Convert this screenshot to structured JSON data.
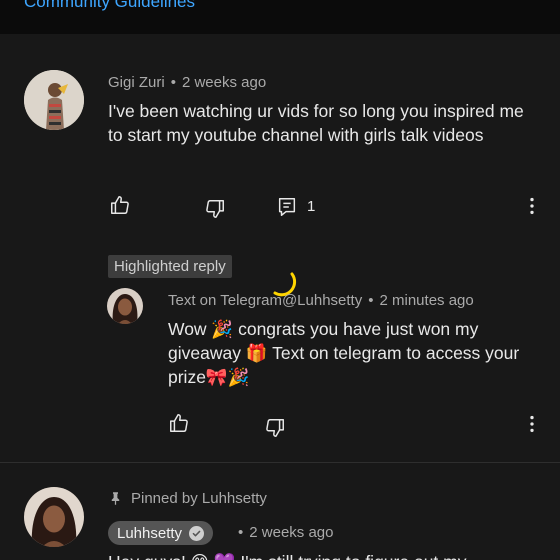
{
  "header": {
    "link": "Community Guidelines"
  },
  "comments": [
    {
      "author": "Gigi Zuri",
      "time": "2 weeks ago",
      "text": "I've been watching ur vids for so long you inspired me to start my youtube channel with girls talk videos",
      "reply_count": "1"
    }
  ],
  "highlighted": {
    "badge": "Highlighted reply",
    "author": "Text on Telegram@Luhhsetty",
    "time": "2 minutes ago",
    "text": "Wow 🎉 congrats you have just won my giveaway 🎁 Text on telegram to access your prize🎀🎉"
  },
  "pinned": {
    "label": "Pinned by Luhhsetty",
    "author": "Luhhsetty",
    "time": "2 weeks ago",
    "text_partial": "Hey guys! 😊 💜 I'm still trying to figure out my"
  },
  "colors": {
    "background": "#181818",
    "link": "#3ea6ff",
    "spinner": "#ffd500"
  },
  "icons": [
    "like-icon",
    "dislike-icon",
    "reply-icon",
    "more-vertical-icon",
    "pin-icon",
    "verified-check-icon",
    "loading-spinner"
  ]
}
